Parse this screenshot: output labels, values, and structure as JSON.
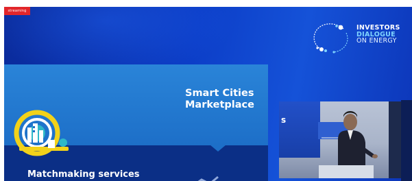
{
  "stream": {
    "live_badge": "streaming"
  },
  "logo": {
    "line1": "INVESTORS",
    "line2": "DIALOGUE",
    "line3": "ON ENERGY",
    "icon": "ring-of-dots-icon"
  },
  "slide": {
    "title_line1": "Smart Cities",
    "title_line2": "Marketplace",
    "subtitle": "Matchmaking services",
    "icon": "smart-city-icon"
  },
  "speaker_video": {
    "screen_text": "s",
    "icon": "speaker-at-podium"
  },
  "colors": {
    "background_blue": "#0c3ec8",
    "panel_light": "#2a84d8",
    "panel_dark": "#0b2f86",
    "accent_yellow": "#f2d21a",
    "accent_cyan": "#7fd4ff",
    "live_red": "#e2262a"
  }
}
